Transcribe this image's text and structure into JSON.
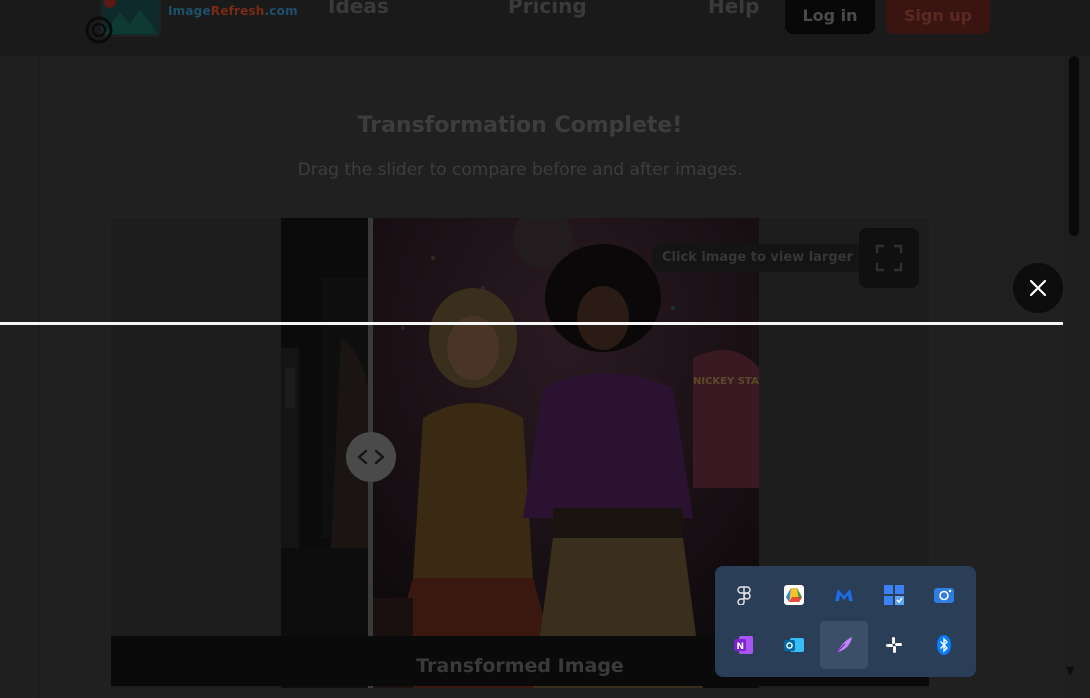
{
  "header": {
    "logo_prefix": "Image",
    "logo_accent": "Refresh",
    "logo_suffix": ".com",
    "nav": [
      "Ideas",
      "Pricing",
      "Help"
    ],
    "login_label": "Log in",
    "signup_label": "Sign up"
  },
  "main": {
    "title": "Transformation Complete!",
    "subtitle": "Drag the slider to compare before and after images.",
    "hint": "Click image to view larger",
    "caption": "Transformed Image",
    "poster_sign": "NICKEY STATION"
  },
  "tray": {
    "icons": [
      "figma-icon",
      "google-drive-icon",
      "malwarebytes-icon",
      "task-board-icon",
      "camera-app-icon",
      "onenote-icon",
      "outlook-icon",
      "quill-feather-icon",
      "slack-icon",
      "bluetooth-icon"
    ],
    "selected_index": 7
  },
  "colors": {
    "header_bg": "#1a1a1a",
    "page_bg": "#1f1f1f",
    "tray_bg": "#2b3e57",
    "signup_bg": "#3a1410"
  }
}
